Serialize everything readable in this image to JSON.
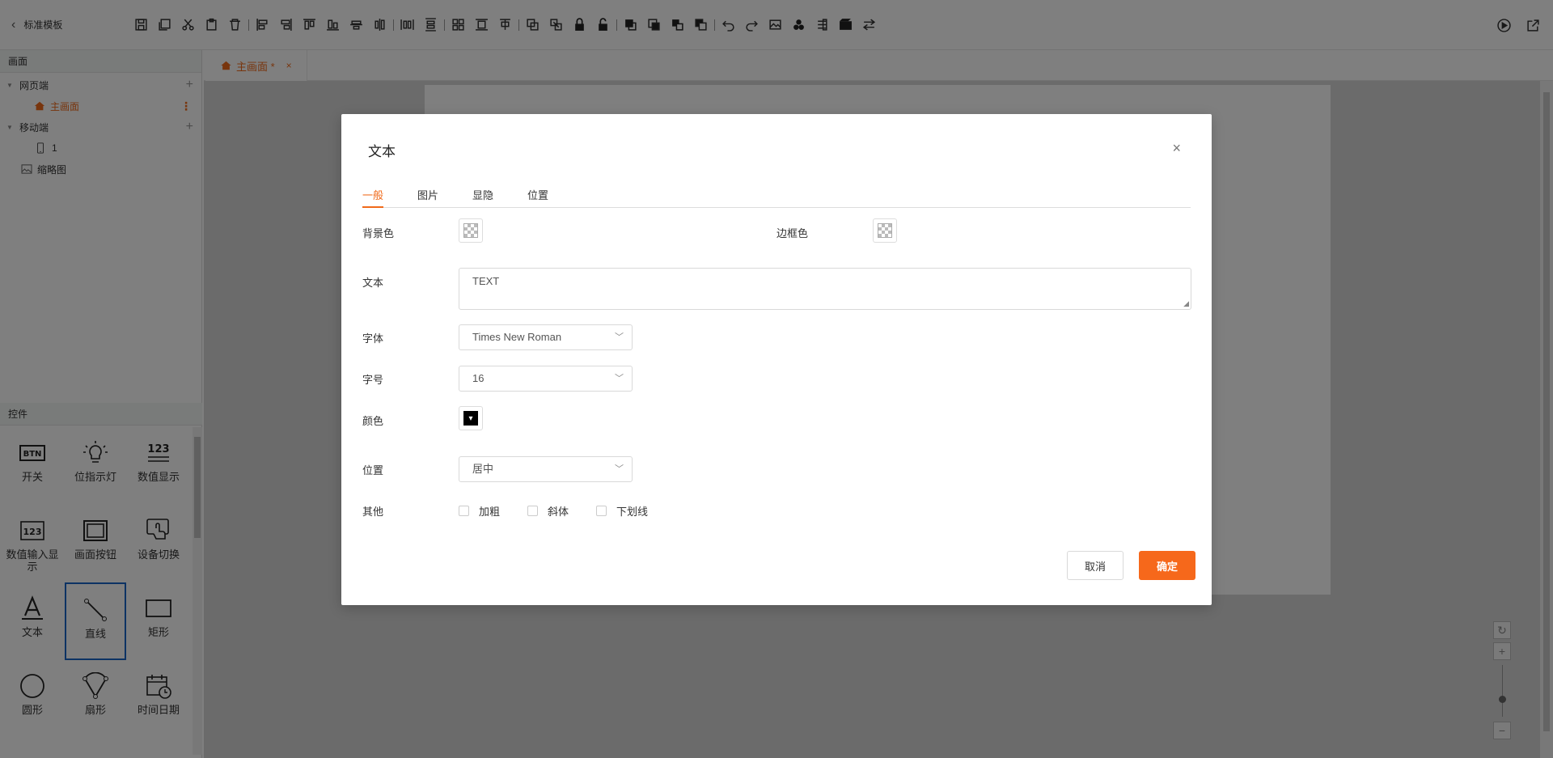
{
  "header": {
    "back_label": "标准模板"
  },
  "toolbar": {
    "icons": [
      "save-icon",
      "save-as-icon",
      "cut-icon",
      "paste-icon",
      "delete-icon",
      "align-left-icon",
      "align-right-icon",
      "align-top-icon",
      "align-bottom-icon",
      "align-center-h-icon",
      "align-center-v-icon",
      "distribute-h-icon",
      "distribute-v-icon",
      "group-icon",
      "same-height-icon",
      "same-width-icon",
      "combine-icon",
      "ungroup-icon",
      "lock-icon",
      "unlock-icon",
      "bring-front-icon",
      "send-back-icon",
      "bring-forward-icon",
      "send-backward-icon",
      "undo-icon",
      "redo-icon",
      "image-icon",
      "layers-icon",
      "properties-icon",
      "video-icon",
      "swap-icon"
    ]
  },
  "sidebar": {
    "screens_title": "画面",
    "web_label": "网页端",
    "main_screen_label": "主画面",
    "mobile_label": "移动端",
    "mobile_item_label": "1",
    "thumbnail_label": "缩略图",
    "controls_title": "控件",
    "controls": [
      {
        "label": "开关",
        "icon": "btn-icon"
      },
      {
        "label": "位指示灯",
        "icon": "bulb-icon"
      },
      {
        "label": "数值显示",
        "icon": "number-display-icon"
      },
      {
        "label": "数值输入显示",
        "icon": "number-input-icon"
      },
      {
        "label": "画面按钮",
        "icon": "screen-button-icon"
      },
      {
        "label": "设备切换",
        "icon": "device-switch-icon"
      },
      {
        "label": "文本",
        "icon": "text-icon"
      },
      {
        "label": "直线",
        "icon": "line-icon"
      },
      {
        "label": "矩形",
        "icon": "rectangle-icon"
      },
      {
        "label": "圆形",
        "icon": "circle-icon"
      },
      {
        "label": "扇形",
        "icon": "sector-icon"
      },
      {
        "label": "时间日期",
        "icon": "calendar-clock-icon"
      }
    ]
  },
  "tabs": {
    "main_tab_label": "主画面 *",
    "close_glyph": "×"
  },
  "dialog": {
    "title": "文本",
    "close_glyph": "×",
    "tabs": [
      "一般",
      "图片",
      "显隐",
      "位置"
    ],
    "active_tab": "一般",
    "bg_color_label": "背景色",
    "border_color_label": "边框色",
    "text_label": "文本",
    "text_value": "TEXT",
    "font_label": "字体",
    "font_value": "Times New Roman",
    "size_label": "字号",
    "size_value": "16",
    "color_label": "颜色",
    "color_value": "#000000",
    "align_label": "位置",
    "align_value": "居中",
    "other_label": "其他",
    "bold_label": "加粗",
    "italic_label": "斜体",
    "underline_label": "下划线",
    "cancel_label": "取消",
    "ok_label": "确定"
  },
  "colors": {
    "accent": "#f06a1a",
    "selection": "#1b66c9"
  }
}
